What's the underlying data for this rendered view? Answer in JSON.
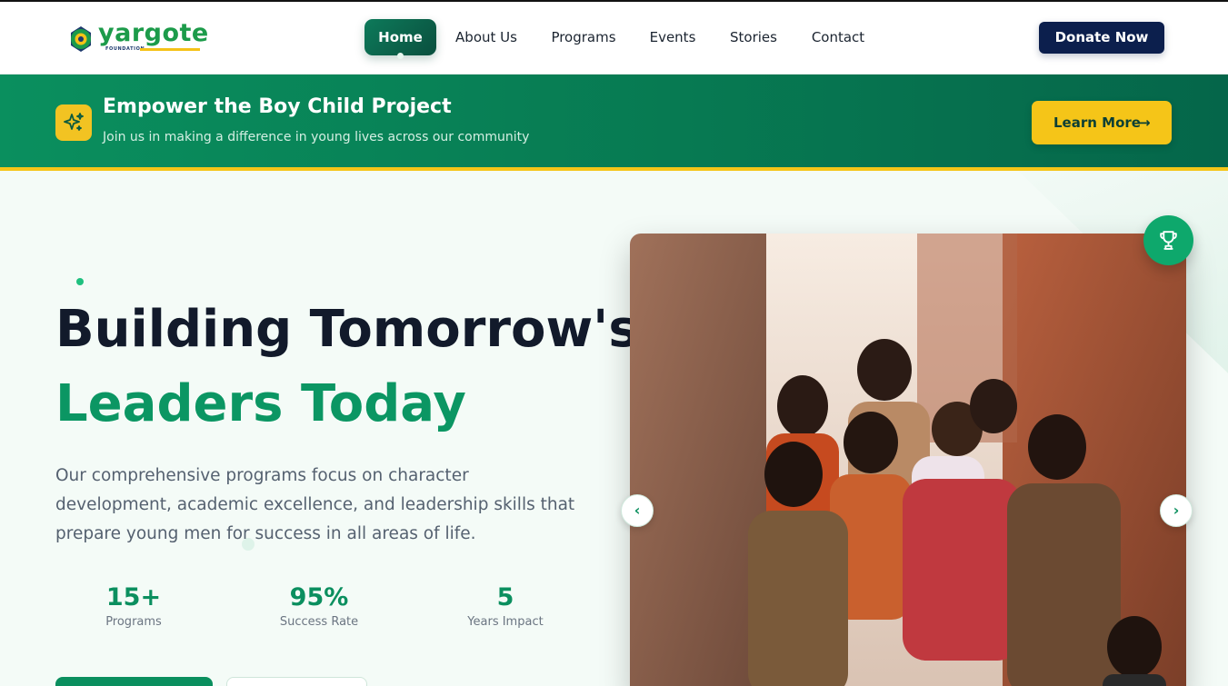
{
  "header": {
    "logo_text": "yargote",
    "logo_sub": "FOUNDATION",
    "nav": [
      {
        "label": "Home"
      },
      {
        "label": "About Us"
      },
      {
        "label": "Programs"
      },
      {
        "label": "Events"
      },
      {
        "label": "Stories"
      },
      {
        "label": "Contact"
      }
    ],
    "donate_label": "Donate Now"
  },
  "banner": {
    "icon": "sparkles-icon",
    "title": "Empower the Boy Child Project",
    "subtitle": "Join us in making a difference in young lives across our community",
    "cta_label": "Learn More",
    "cta_icon": "arrow-right-icon"
  },
  "hero": {
    "title_line1": "Building Tomorrow's",
    "title_line2": "Leaders Today",
    "description": "Our comprehensive programs focus on character development, academic excellence, and leadership skills that prepare young men for success in all areas of life.",
    "stats": [
      {
        "value": "15+",
        "label": "Programs"
      },
      {
        "value": "95%",
        "label": "Success Rate"
      },
      {
        "value": "5",
        "label": "Years Impact"
      }
    ]
  },
  "carousel": {
    "badge_icon": "trophy-icon",
    "prev_icon": "chevron-left-icon",
    "next_icon": "chevron-right-icon",
    "prev_glyph": "‹",
    "next_glyph": "›"
  },
  "colors": {
    "brand_green": "#0b9663",
    "navy": "#0c1f4d",
    "accent_yellow": "#f5c518"
  }
}
